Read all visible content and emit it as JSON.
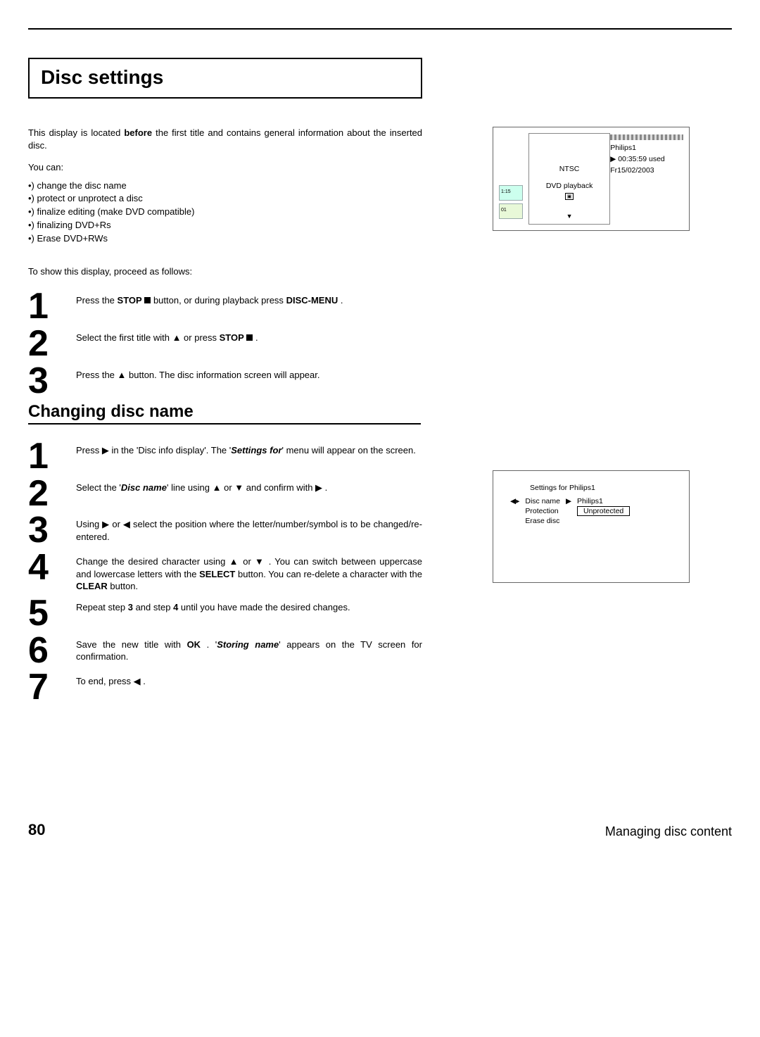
{
  "header_rule": true,
  "title": "Disc settings",
  "intro": {
    "pre": "This display is located ",
    "bold": "before",
    "post": " the first title and contains general information about the inserted disc."
  },
  "you_can_label": "You can:",
  "bullets": [
    "change the disc name",
    "protect or unprotect a disc",
    "finalize editing (make DVD compatible)",
    "finalizing DVD+Rs",
    "Erase DVD+RWs"
  ],
  "show_display": "To show this display, proceed as follows:",
  "stepsA": [
    {
      "n": "1",
      "pre": "Press the ",
      "b1": "STOP",
      "mid1": " ",
      "icon": "stop",
      "mid2": " button, or during playback press ",
      "b2": "DISC-MENU",
      "post": " ."
    },
    {
      "n": "2",
      "pre": "Select the first title with ",
      "icon1": "up",
      "mid": " or press ",
      "b": "STOP",
      "icon2": "stop",
      "post": " ."
    },
    {
      "n": "3",
      "pre": "Press the ",
      "icon": "up",
      "post": " button. The disc information screen will appear."
    }
  ],
  "subhead": "Changing disc name",
  "stepsB": [
    {
      "n": "1",
      "t": [
        "Press ",
        "▶",
        " in the 'Disc info display'. The '",
        "Settings for",
        "' menu will appear on the screen."
      ]
    },
    {
      "n": "2",
      "t": [
        "Select the '",
        "Disc name",
        "' line using ",
        "▲",
        " or ",
        "▼",
        " and confirm with ",
        "▶",
        " ."
      ]
    },
    {
      "n": "3",
      "t": [
        "Using ",
        "▶",
        " or ",
        "◀",
        " select the position where the letter/number/symbol is to be changed/re-entered."
      ]
    },
    {
      "n": "4",
      "t": [
        "Change the desired character using ",
        "▲",
        " or ",
        "▼",
        " . You can switch between uppercase and lowercase letters with the ",
        "SELECT",
        " button. You can re-delete a character with the ",
        "CLEAR",
        " button."
      ]
    },
    {
      "n": "5",
      "t": [
        "Repeat step ",
        "3",
        " and step ",
        "4",
        " until you have made the desired changes."
      ]
    },
    {
      "n": "6",
      "t": [
        "Save the new title with ",
        "OK",
        " . '",
        "Storing name",
        "' appears on the TV screen for confirmation."
      ]
    },
    {
      "n": "7",
      "t": [
        "To end, press ",
        "◀",
        " ."
      ]
    }
  ],
  "tv1": {
    "clock": "1:15",
    "track": "01",
    "ntsc": "NTSC",
    "mode": "DVD playback",
    "name": "Philips1",
    "used": "00:35:59 used",
    "date": "Fr15/02/2003"
  },
  "tv2": {
    "title": "Settings for Philips1",
    "row1k": "Disc name",
    "row1v": "Philips1",
    "row2k": "Protection",
    "row2v": "Unprotected",
    "row3k": "Erase disc"
  },
  "footer": {
    "page": "80",
    "title": "Managing disc content"
  }
}
